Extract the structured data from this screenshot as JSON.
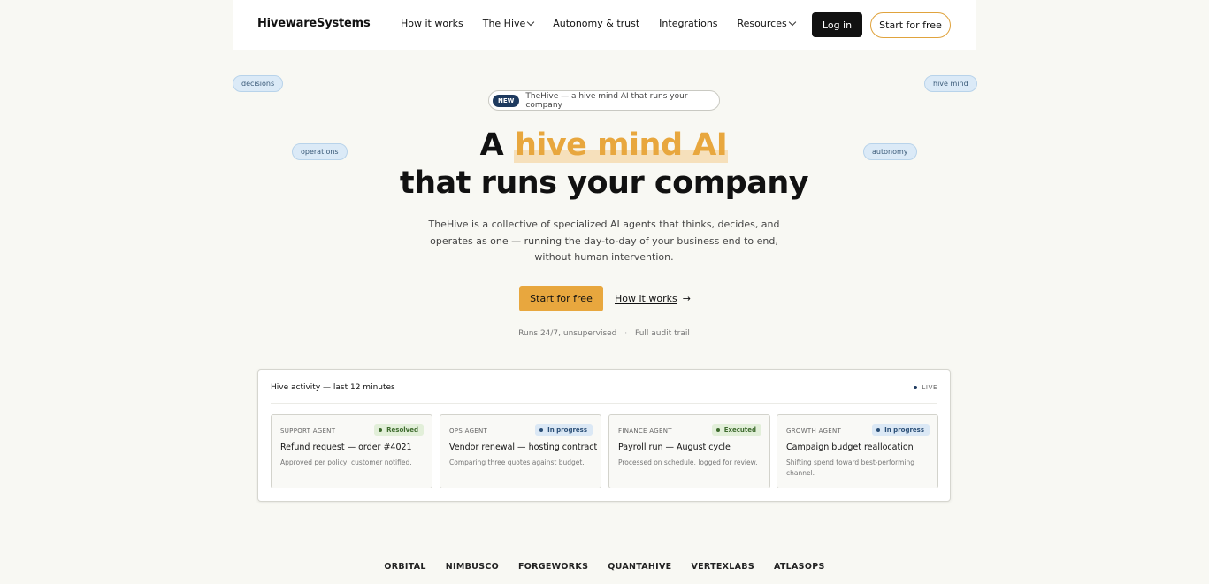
{
  "header": {
    "logo": "HivewareSystems",
    "nav": [
      {
        "label": "How it works",
        "dropdown": false
      },
      {
        "label": "The Hive",
        "dropdown": true
      },
      {
        "label": "Autonomy & trust",
        "dropdown": false
      },
      {
        "label": "Integrations",
        "dropdown": false
      },
      {
        "label": "Resources",
        "dropdown": true
      }
    ],
    "login_label": "Log in",
    "start_label": "Start for free"
  },
  "tags": {
    "decisions": "decisions",
    "hive_mind": "hive mind",
    "operations": "operations",
    "autonomy": "autonomy"
  },
  "pill": {
    "badge": "NEW",
    "text": "TheHive — a hive mind AI that runs your company"
  },
  "hero": {
    "headline_prefix": "A",
    "headline_accent": "hive mind AI",
    "headline_line2": "that runs your company",
    "subtitle": "TheHive is a collective of specialized AI agents that thinks, decides, and operates as one — running the day-to-day of your business end to end, without human intervention.",
    "primary_cta": "Start for free",
    "secondary_cta": "How it works",
    "secondary_arrow": "→",
    "meta_1": "Runs 24/7, unsupervised",
    "meta_sep": "·",
    "meta_2": "Full audit trail"
  },
  "activity": {
    "title": "Hive activity — last 12 minutes",
    "live": "LIVE",
    "cards": [
      {
        "agent": "SUPPORT AGENT",
        "status": "Resolved",
        "status_color": "green",
        "title": "Refund request — order #4021",
        "desc": "Approved per policy, customer notified."
      },
      {
        "agent": "OPS AGENT",
        "status": "In progress",
        "status_color": "blue",
        "title": "Vendor renewal — hosting contract",
        "desc": "Comparing three quotes against budget."
      },
      {
        "agent": "FINANCE AGENT",
        "status": "Executed",
        "status_color": "green",
        "title": "Payroll run — August cycle",
        "desc": "Processed on schedule, logged for review."
      },
      {
        "agent": "GROWTH AGENT",
        "status": "In progress",
        "status_color": "blue",
        "title": "Campaign budget reallocation",
        "desc": "Shifting spend toward best-performing channel."
      }
    ]
  },
  "logos": [
    "ORBITAL",
    "NIMBUSCO",
    "FORGEWORKS",
    "QUANTAHIVE",
    "VERTEXLABS",
    "ATLASOPS"
  ],
  "colors": {
    "accent": "#e8a73e",
    "navy": "#1e3a5f",
    "background": "#f8f8f3"
  }
}
